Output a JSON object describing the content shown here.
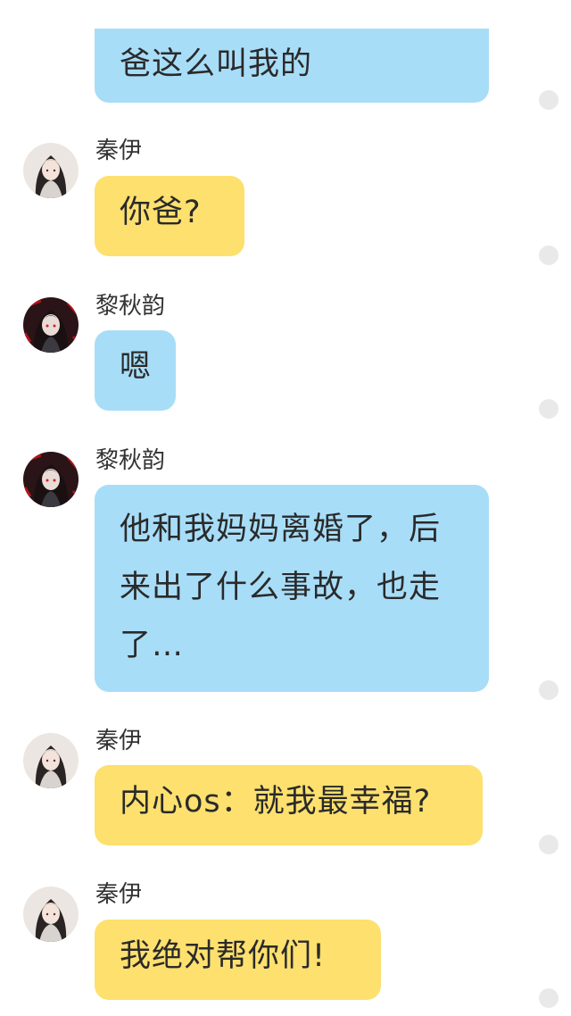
{
  "colors": {
    "bubble_blue": "#a8ddf8",
    "bubble_yellow": "#fde06e",
    "dot_gray": "#e9e9e9"
  },
  "messages": [
    {
      "sender": "",
      "text": "爸这么叫我的",
      "bubble_color": "blue",
      "avatar": "none"
    },
    {
      "sender": "秦伊",
      "text": "你爸?",
      "bubble_color": "yellow",
      "avatar": "qinyi-avatar-icon"
    },
    {
      "sender": "黎秋韵",
      "text": "嗯",
      "bubble_color": "blue",
      "avatar": "liqiuyun-avatar-icon"
    },
    {
      "sender": "黎秋韵",
      "text": "他和我妈妈离婚了，后来出了什么事故，也走了…",
      "bubble_color": "blue",
      "avatar": "liqiuyun-avatar-icon"
    },
    {
      "sender": "秦伊",
      "text": "内心os：就我最幸福?",
      "bubble_color": "yellow",
      "avatar": "qinyi-avatar-icon"
    },
    {
      "sender": "秦伊",
      "text": "我绝对帮你们!",
      "bubble_color": "yellow",
      "avatar": "qinyi-avatar-icon"
    }
  ]
}
